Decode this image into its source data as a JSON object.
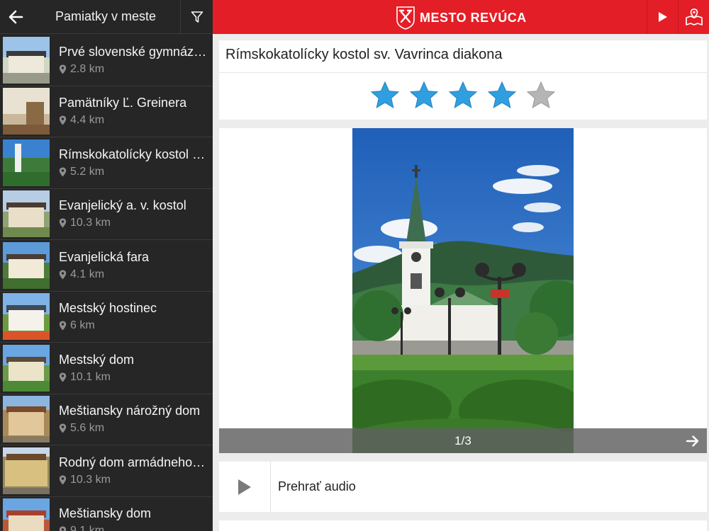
{
  "sidebar": {
    "title": "Pamiatky v meste",
    "back_icon": "arrow-left-icon",
    "filter_icon": "filter-icon",
    "items": [
      {
        "name": "Prvé slovenské gymnázium",
        "distance": "2.8 km"
      },
      {
        "name": "Pamätníky Ľ. Greinera",
        "distance": "4.4 km"
      },
      {
        "name": "Rímskokatolícky kostol sv. Vavrinca diakona",
        "distance": "5.2 km"
      },
      {
        "name": "Evanjelický a. v. kostol",
        "distance": "10.3 km"
      },
      {
        "name": "Evanjelická fara",
        "distance": "4.1 km"
      },
      {
        "name": "Mestský hostinec",
        "distance": "6 km"
      },
      {
        "name": "Mestský dom",
        "distance": "10.1 km"
      },
      {
        "name": "Meštiansky nárožný dom",
        "distance": "5.6 km"
      },
      {
        "name": "Rodný dom armádneho generála",
        "distance": "10.3 km"
      },
      {
        "name": "Meštiansky dom",
        "distance": "9.1 km"
      }
    ]
  },
  "topbar": {
    "brand": "MESTO  REVÚCA",
    "play_icon": "play-icon",
    "map_icon": "map-icon",
    "color": "#e41e26"
  },
  "detail": {
    "title": "Rímskokatolícky kostol sv. Vavrinca diakona",
    "rating": 4,
    "rating_max": 5,
    "gallery_counter": "1/3",
    "audio_label": "Prehrať audio"
  },
  "colors": {
    "star_on": "#2f9fe0",
    "star_off": "#b5b5b5"
  }
}
